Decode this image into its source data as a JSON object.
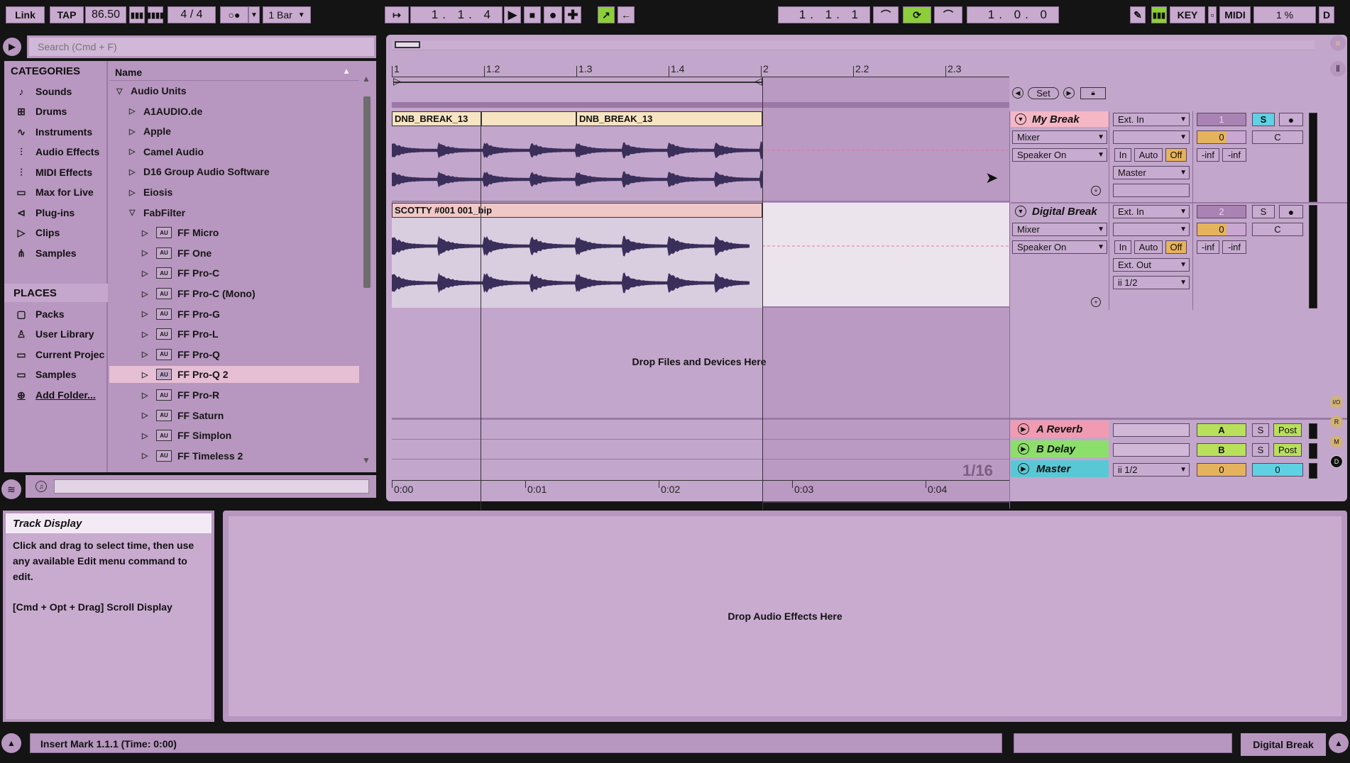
{
  "transport": {
    "link": "Link",
    "tap": "TAP",
    "tempo": "86.50",
    "time_sig": "4 / 4",
    "quantize": "1 Bar",
    "arrangement_position": "1.  1.  4",
    "loop_start": "1.  1.  1",
    "loop_length": "1.  0.  0",
    "key": "KEY",
    "midi": "MIDI",
    "cpu": "1 %",
    "disk": "D"
  },
  "browser": {
    "search_placeholder": "Search (Cmd + F)",
    "categories_header": "CATEGORIES",
    "categories": [
      {
        "label": "Sounds",
        "icon": "note-icon"
      },
      {
        "label": "Drums",
        "icon": "grid-icon"
      },
      {
        "label": "Instruments",
        "icon": "wave-icon"
      },
      {
        "label": "Audio Effects",
        "icon": "sliders-icon"
      },
      {
        "label": "MIDI Effects",
        "icon": "midi-sliders-icon"
      },
      {
        "label": "Max for Live",
        "icon": "max-icon"
      },
      {
        "label": "Plug-ins",
        "icon": "plugin-icon"
      },
      {
        "label": "Clips",
        "icon": "clip-icon"
      },
      {
        "label": "Samples",
        "icon": "waveform-icon"
      }
    ],
    "places_header": "PLACES",
    "places": [
      {
        "label": "Packs",
        "icon": "box-icon"
      },
      {
        "label": "User Library",
        "icon": "user-icon"
      },
      {
        "label": "Current Projec",
        "icon": "folder-icon"
      },
      {
        "label": "Samples",
        "icon": "folder-icon"
      },
      {
        "label": "Add Folder...",
        "icon": "plus-circle-icon"
      }
    ],
    "name_header": "Name",
    "items": [
      {
        "label": "Audio Units",
        "indent": 0,
        "expanded": true,
        "plugin": false
      },
      {
        "label": "A1AUDIO.de",
        "indent": 1,
        "expanded": false,
        "plugin": false
      },
      {
        "label": "Apple",
        "indent": 1,
        "expanded": false,
        "plugin": false
      },
      {
        "label": "Camel Audio",
        "indent": 1,
        "expanded": false,
        "plugin": false
      },
      {
        "label": "D16 Group Audio Software",
        "indent": 1,
        "expanded": false,
        "plugin": false
      },
      {
        "label": "Eiosis",
        "indent": 1,
        "expanded": false,
        "plugin": false
      },
      {
        "label": "FabFilter",
        "indent": 1,
        "expanded": true,
        "plugin": false
      },
      {
        "label": "FF Micro",
        "indent": 2,
        "expanded": false,
        "plugin": true
      },
      {
        "label": "FF One",
        "indent": 2,
        "expanded": false,
        "plugin": true
      },
      {
        "label": "FF Pro-C",
        "indent": 2,
        "expanded": false,
        "plugin": true
      },
      {
        "label": "FF Pro-C (Mono)",
        "indent": 2,
        "expanded": false,
        "plugin": true
      },
      {
        "label": "FF Pro-G",
        "indent": 2,
        "expanded": false,
        "plugin": true
      },
      {
        "label": "FF Pro-L",
        "indent": 2,
        "expanded": false,
        "plugin": true
      },
      {
        "label": "FF Pro-Q",
        "indent": 2,
        "expanded": false,
        "plugin": true
      },
      {
        "label": "FF Pro-Q 2",
        "indent": 2,
        "expanded": false,
        "plugin": true,
        "selected": true
      },
      {
        "label": "FF Pro-R",
        "indent": 2,
        "expanded": false,
        "plugin": true
      },
      {
        "label": "FF Saturn",
        "indent": 2,
        "expanded": false,
        "plugin": true
      },
      {
        "label": "FF Simplon",
        "indent": 2,
        "expanded": false,
        "plugin": true
      },
      {
        "label": "FF Timeless 2",
        "indent": 2,
        "expanded": false,
        "plugin": true
      }
    ]
  },
  "arrangement": {
    "ruler_bars": [
      "1",
      "1.2",
      "1.3",
      "1.4",
      "2",
      "2.2",
      "2.3"
    ],
    "time_labels": [
      "0:00",
      "0:01",
      "0:02",
      "0:03",
      "0:04"
    ],
    "grid": "1/16",
    "drop_files": "Drop Files and Devices Here",
    "set_label": "Set",
    "tracks": [
      {
        "name": "My Break",
        "number": "1",
        "title_color": "#f5b7c6",
        "clips": [
          "DNB_BREAK_13",
          "DNB_BREAK_13"
        ],
        "input_type": "Ext. In",
        "monitor": "Mixer",
        "channel": "Speaker On",
        "output": "Master",
        "pan": "C",
        "vol": "0",
        "solo": "S",
        "in": "In",
        "auto": "Auto",
        "off": "Off",
        "peak_l": "-inf",
        "peak_r": "-inf"
      },
      {
        "name": "Digital Break",
        "number": "2",
        "title_color": "#c8abd0",
        "clips": [
          "SCOTTY #001 001_bip"
        ],
        "input_type": "Ext. In",
        "monitor": "Mixer",
        "channel": "Speaker On",
        "output": "Ext. Out",
        "output_channel": "ii 1/2",
        "pan": "C",
        "vol": "0",
        "solo": "S",
        "in": "In",
        "auto": "Auto",
        "off": "Off",
        "peak_l": "-inf",
        "peak_r": "-inf"
      }
    ],
    "returns": [
      {
        "name": "A Reverb",
        "letter": "A",
        "solo": "S",
        "post": "Post",
        "color": "#f09bb2"
      },
      {
        "name": "B Delay",
        "letter": "B",
        "solo": "S",
        "post": "Post",
        "color": "#8ddf6b"
      }
    ],
    "master": {
      "name": "Master",
      "output": "ii 1/2",
      "vol": "0",
      "pan": "0",
      "color": "#59c8d5"
    }
  },
  "info": {
    "title": "Track Display",
    "body": "Click and drag to select time, then use any available Edit menu command to edit.",
    "hint": "[Cmd + Opt + Drag] Scroll Display"
  },
  "detail": {
    "drop_effects": "Drop Audio Effects Here"
  },
  "status": {
    "message": "Insert Mark 1.1.1 (Time: 0:00)",
    "selected_track": "Digital Break"
  },
  "colors": {
    "accent": "#b796bf",
    "clip": "#f7e4c2",
    "loop": "#8ccf39",
    "selected": "#e7bfd5"
  }
}
